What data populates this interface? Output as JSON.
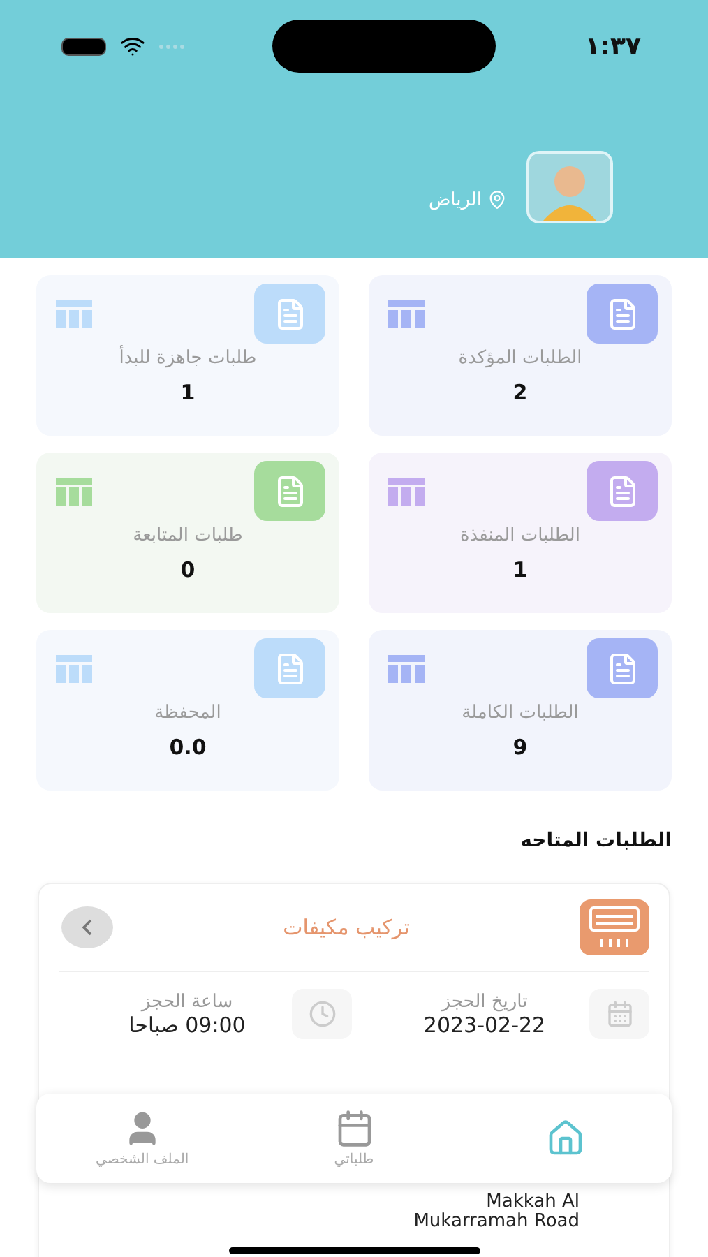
{
  "status_bar": {
    "time": "١:٣٧"
  },
  "profile": {
    "location": "الرياض"
  },
  "stats": [
    {
      "label": "الطلبات المؤكدة",
      "value": "2",
      "color": "#a5b4f5"
    },
    {
      "label": "طلبات جاهزة للبدأ",
      "value": "1",
      "color": "#bcdcfa"
    },
    {
      "label": "الطلبات المنفذة",
      "value": "1",
      "color": "#c3acef"
    },
    {
      "label": "طلبات المتابعة",
      "value": "0",
      "color": "#a6dc9c"
    },
    {
      "label": "الطلبات الكاملة",
      "value": "9",
      "color": "#a5b4f5"
    },
    {
      "label": "المحفظة",
      "value": "0.0",
      "color": "#bcdcfa"
    }
  ],
  "section_title": "الطلبات المتاحه",
  "order": {
    "service": "تركيب مكيفات",
    "date_label": "تاريخ الحجز",
    "date": "2023-02-22",
    "time_label": "ساعة الحجز",
    "time": "09:00 صباحا",
    "address": "Makkah Al Mukarramah Road"
  },
  "nav": [
    {
      "kind": "home",
      "selected": true
    },
    {
      "kind": "orders",
      "label": "طلباتي",
      "selected": false
    },
    {
      "kind": "profile",
      "label": "الملف الشخصي",
      "selected": false
    }
  ]
}
